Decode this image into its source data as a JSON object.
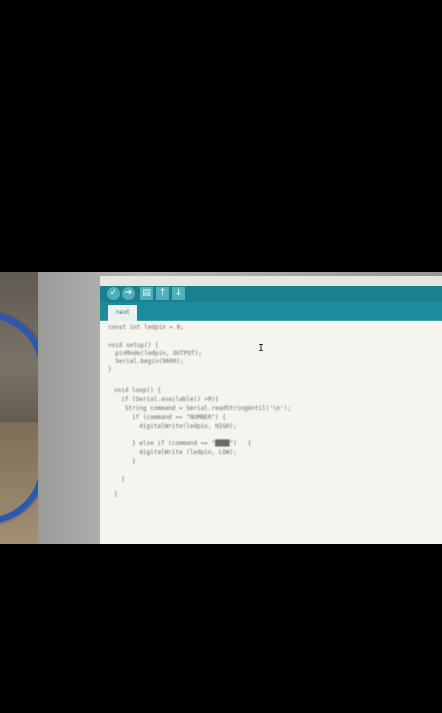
{
  "toolbar": {
    "verify_icon": "✓",
    "upload_icon": "➜",
    "new_icon": "▤",
    "open_icon": "↑",
    "save_icon": "↓"
  },
  "tab": {
    "label": "next"
  },
  "code": {
    "lines": [
      "const int ledpin = 8;",
      "",
      "void setup() {",
      "  pinMode(ledpin, OUTPUT);",
      "  Serial.begin(9600);",
      "}",
      "",
      "void loop() {",
      "  if (Serial.available() >0){",
      "   String command = Serial.readStringUntil('\\n');",
      "     if (command == \"NUMBER\") {",
      "       digitalWrite(ledpin, HIGH);",
      "",
      "     } else if (command == \"████\")   {",
      "       digitalWrite (ledpin, LOW);",
      "     }",
      "  }",
      "}"
    ]
  },
  "colors": {
    "toolbar": "#1b7f8f",
    "tabbar": "#1a8c9c",
    "editor_bg": "#f6f4ee",
    "keyword": "#c2852e",
    "selection": "#e8a04a"
  }
}
